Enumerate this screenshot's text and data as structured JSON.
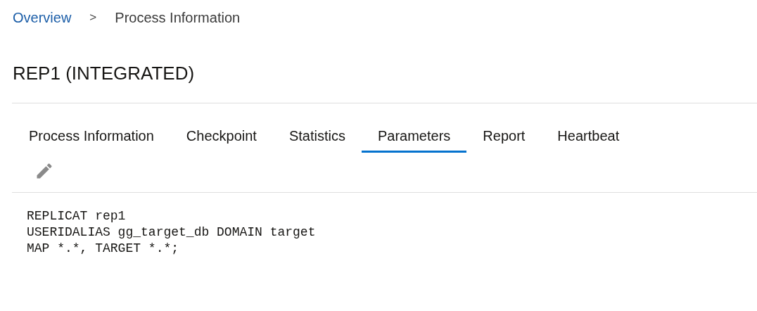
{
  "breadcrumb": {
    "items": [
      {
        "label": "Overview",
        "kind": "link"
      },
      {
        "label": "Process Information",
        "kind": "current"
      }
    ],
    "separator": ">"
  },
  "title": "REP1 (INTEGRATED)",
  "tabs": [
    {
      "label": "Process Information",
      "selected": false
    },
    {
      "label": "Checkpoint",
      "selected": false
    },
    {
      "label": "Statistics",
      "selected": false
    },
    {
      "label": "Parameters",
      "selected": true
    },
    {
      "label": "Report",
      "selected": false
    },
    {
      "label": "Heartbeat",
      "selected": false
    }
  ],
  "parameters": [
    "REPLICAT rep1",
    "USERIDALIAS gg_target_db DOMAIN target",
    "MAP *.*, TARGET *.*;"
  ]
}
